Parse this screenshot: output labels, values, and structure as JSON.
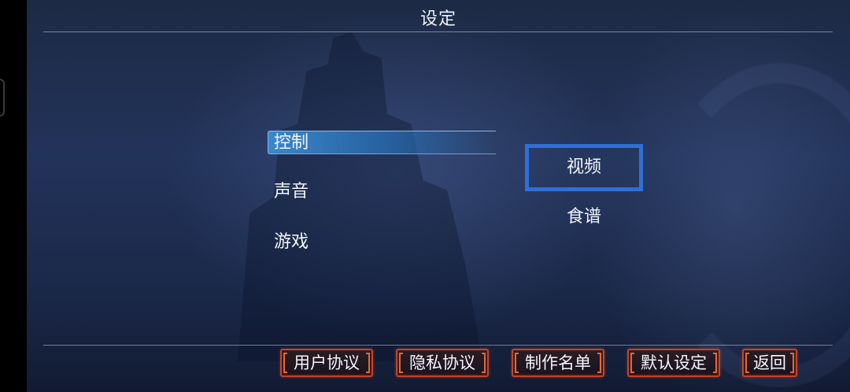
{
  "header": {
    "title": "设定"
  },
  "menu": {
    "items": [
      {
        "label": "控制",
        "selected": true
      },
      {
        "label": "声音",
        "selected": false
      },
      {
        "label": "游戏",
        "selected": false
      }
    ]
  },
  "submenu": {
    "items": [
      {
        "label": "视频",
        "focused": true
      },
      {
        "label": "食谱",
        "focused": false
      }
    ]
  },
  "footer": {
    "buttons": [
      {
        "label": "用户协议"
      },
      {
        "label": "隐私协议"
      },
      {
        "label": "制作名单"
      },
      {
        "label": "默认设定"
      },
      {
        "label": "返回"
      }
    ]
  },
  "colors": {
    "selected_highlight": "#3c8cd2",
    "focus_border": "#2f6fd6",
    "button_border": "#c2462a"
  }
}
